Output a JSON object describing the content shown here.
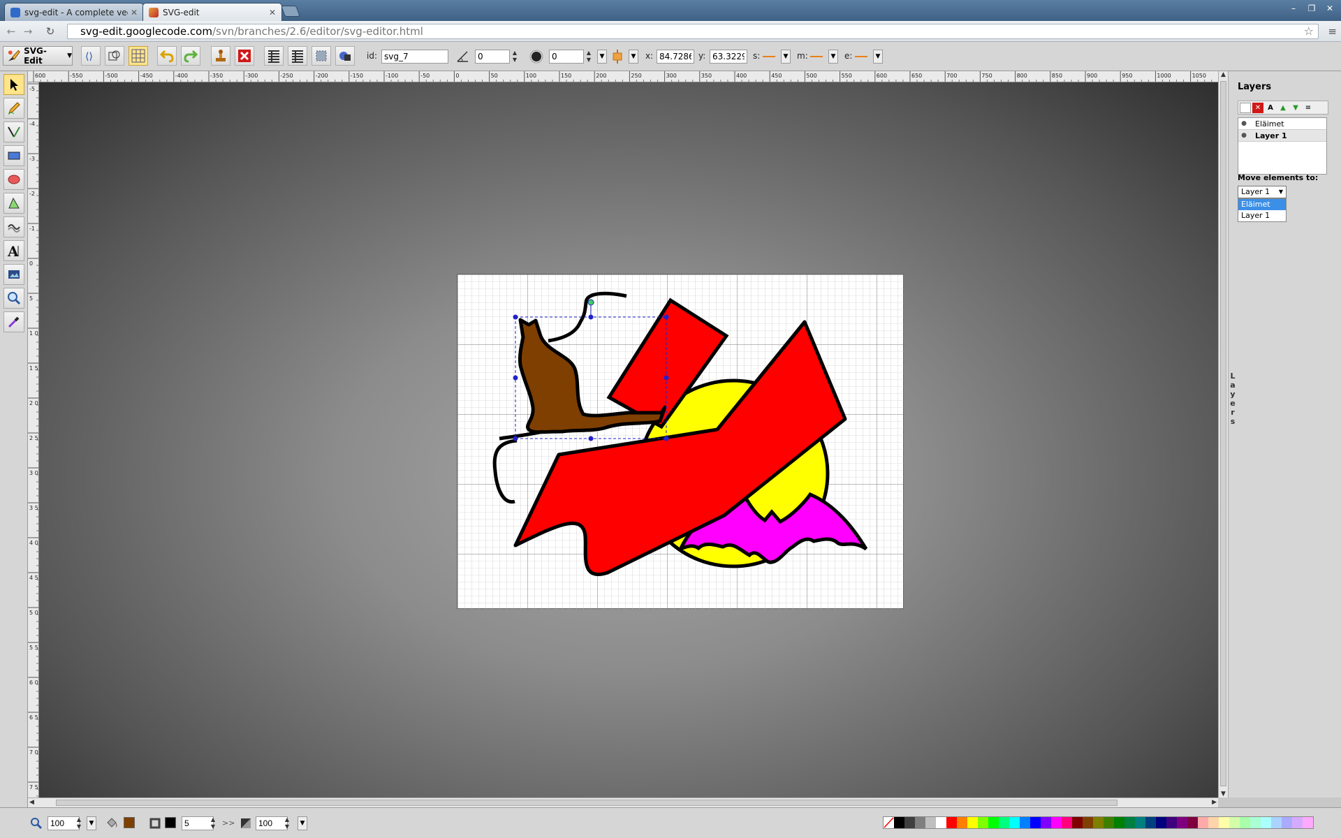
{
  "browser": {
    "tabs": [
      {
        "title": "svg-edit - A complete vec",
        "active": false
      },
      {
        "title": "SVG-edit",
        "active": true
      }
    ],
    "url_host": "svg-edit.googlecode.com",
    "url_path": "/svn/branches/2.6/editor/svg-editor.html"
  },
  "toolbar": {
    "logo_label": "SVG-Edit",
    "id_label": "id:",
    "id_value": "svg_7",
    "angle_value": "0",
    "blur_value": "0",
    "x_label": "x:",
    "x_value": "84.7286",
    "y_label": "y:",
    "y_value": "63.3229",
    "s_label": "s:",
    "m_label": "m:",
    "e_label": "e:"
  },
  "ruler": {
    "top_ticks": [
      "600",
      "-550",
      "-500",
      "-450",
      "-400",
      "-350",
      "-300",
      "-250",
      "-200",
      "-150",
      "-100",
      "-50",
      "0",
      "50",
      "100",
      "150",
      "200",
      "250",
      "300",
      "350",
      "400",
      "450",
      "500",
      "550",
      "600",
      "650",
      "700",
      "750",
      "800",
      "850",
      "900",
      "950",
      "1000",
      "1050"
    ],
    "left_ticks": [
      "-5",
      "-4",
      "-3",
      "-2",
      "-1",
      "0",
      "5",
      "1 0",
      "1 5",
      "2 0",
      "2 5",
      "3 0",
      "3 5",
      "4 0",
      "4 5",
      "5 0",
      "5 5",
      "6 0",
      "6 5",
      "7 0",
      "7 5"
    ]
  },
  "layers_panel": {
    "title": "Layers",
    "layers": [
      {
        "name": "Eläimet",
        "current": false
      },
      {
        "name": "Layer 1",
        "current": true
      }
    ],
    "move_label": "Move elements to:",
    "move_selected": "Layer 1",
    "move_options": [
      "Eläimet",
      "Layer 1"
    ],
    "handle_text": "Layers"
  },
  "bottom": {
    "zoom_value": "100",
    "stroke_width": "5",
    "opacity": "100",
    "fill_color": "#7f3f00",
    "stroke_color": "#000000",
    "palette": [
      "#000000",
      "#3f3f3f",
      "#7f7f7f",
      "#bfbfbf",
      "#ffffff",
      "#ff0000",
      "#ff7f00",
      "#ffff00",
      "#7fff00",
      "#00ff00",
      "#00ff7f",
      "#00ffff",
      "#007fff",
      "#0000ff",
      "#7f00ff",
      "#ff00ff",
      "#ff007f",
      "#7f0000",
      "#7f3f00",
      "#7f7f00",
      "#3f7f00",
      "#007f00",
      "#007f3f",
      "#007f7f",
      "#003f7f",
      "#00007f",
      "#3f007f",
      "#7f007f",
      "#7f003f",
      "#ffaaaa",
      "#ffd4aa",
      "#ffffaa",
      "#d4ffaa",
      "#aaffaa",
      "#aaffd4",
      "#aaffff",
      "#aad4ff",
      "#aaaaff",
      "#d4aaff",
      "#ffaaff"
    ]
  },
  "colors": {
    "accent_active": "#ffe48a",
    "shape_red": "#ff0000",
    "shape_yellow": "#ffff00",
    "shape_brown": "#7f3f00",
    "shape_magenta": "#ff00ff",
    "selection": "#2222cc"
  }
}
